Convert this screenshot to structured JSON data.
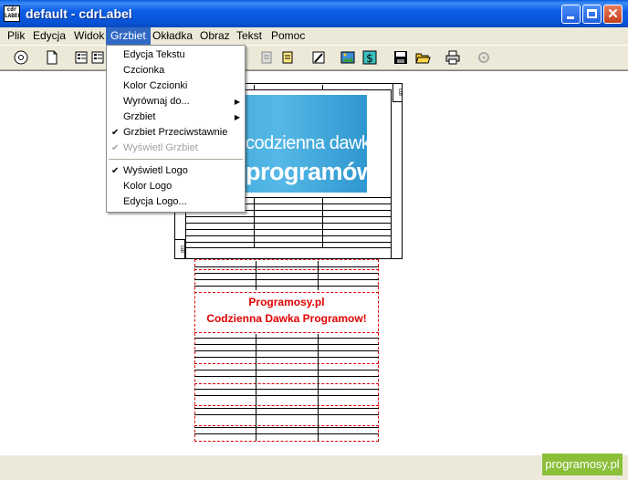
{
  "window": {
    "title": "default - cdrLabel",
    "app_icon_text": "cdr LABEL"
  },
  "menubar": [
    "Plik",
    "Edycja",
    "Widok",
    "Grzbiet",
    "Okładka",
    "Obraz",
    "Tekst",
    "Pomoc"
  ],
  "active_menu": "Grzbiet",
  "dropdown": {
    "items": [
      {
        "label": "Edycja Tekstu"
      },
      {
        "label": "Czcionka"
      },
      {
        "label": "Kolor Czcionki"
      },
      {
        "label": "Wyrównaj do..."
      },
      {
        "label": "Grzbiet"
      },
      {
        "label": "Grzbiet Przeciwstawnie"
      },
      {
        "label": "Wyświetl Grzbiet"
      },
      {
        "label": "Wyświetl Logo"
      },
      {
        "label": "Kolor Logo"
      },
      {
        "label": "Edycja Logo..."
      }
    ]
  },
  "toolbar": {
    "icons": [
      "cd-icon",
      "new-file-icon",
      "list-icon",
      "list-icon",
      "label-icon",
      "label-icon",
      "edit-icon",
      "image-icon",
      "dollar-icon",
      "save-icon",
      "open-folder-icon",
      "print-icon",
      "settings-icon"
    ]
  },
  "cover": {
    "logo_line1": "codzienna dawka",
    "logo_line2": "programów",
    "spine_top": "cdr",
    "spine_bottom": "cdr"
  },
  "back": {
    "line1": "Programosy.pl",
    "line2": "Codzienna Dawka Programow!"
  },
  "watermark": "programosy.pl",
  "colors": {
    "menu_highlight": "#316ac5",
    "title_bar": "#0854d8",
    "back_text": "#e00000",
    "back_dash": "#dd0000"
  }
}
